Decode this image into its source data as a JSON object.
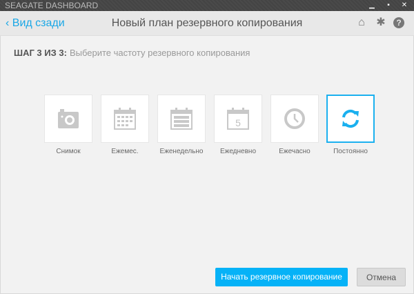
{
  "window": {
    "title": "SEAGATE DASHBOARD"
  },
  "header": {
    "back_label": "Вид сзади",
    "title": "Новый план резервного копирования"
  },
  "step": {
    "prefix": "ШАГ 3 ИЗ 3:",
    "text": "Выберите частоту резервного копирования"
  },
  "options": [
    {
      "label": "Снимок",
      "icon": "camera-icon"
    },
    {
      "label": "Ежемес.",
      "icon": "calendar-month-icon"
    },
    {
      "label": "Еженедельно",
      "icon": "calendar-week-icon"
    },
    {
      "label": "Ежедневно",
      "icon": "calendar-day-icon",
      "day": "5"
    },
    {
      "label": "Ежечасно",
      "icon": "clock-icon"
    },
    {
      "label": "Постоянно",
      "icon": "sync-icon",
      "selected": true
    }
  ],
  "buttons": {
    "start": "Начать резервное копирование",
    "cancel": "Отмена"
  },
  "colors": {
    "accent": "#1ab0ef",
    "button": "#06b2f7"
  }
}
